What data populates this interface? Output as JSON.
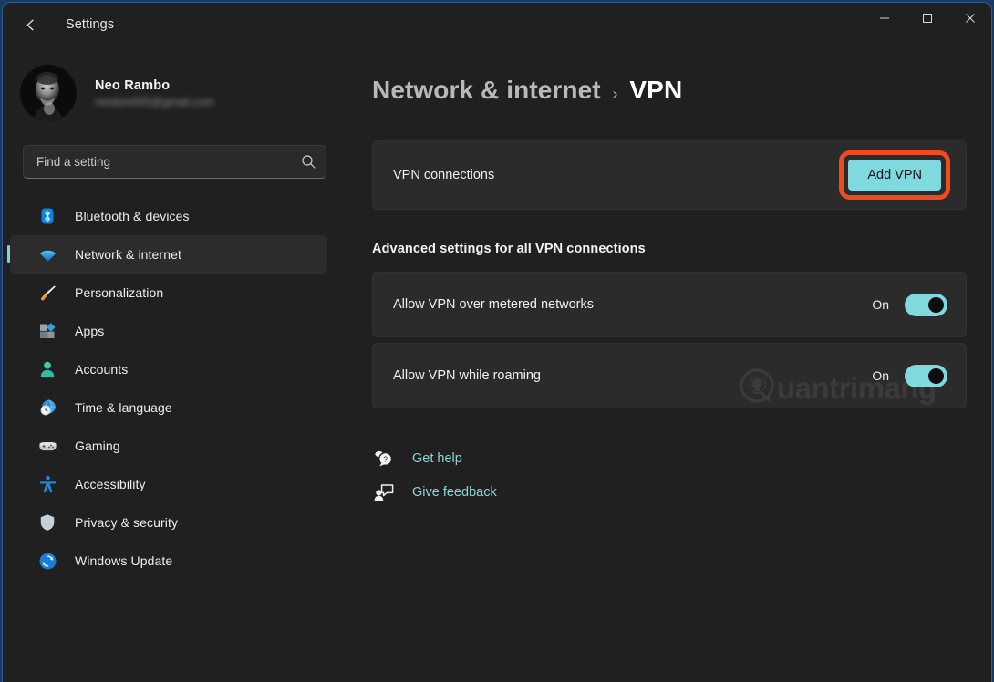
{
  "window": {
    "app_title": "Settings",
    "back_icon": "back-arrow-icon",
    "minimize_label": "—",
    "maximize_label": "□",
    "close_label": "✕",
    "accent_color": "#2f5b93",
    "background_color": "#202020"
  },
  "sidebar": {
    "profile": {
      "name": "Neo Rambo",
      "email": "neokim005@gmail.com",
      "avatar_name": "user-avatar"
    },
    "search": {
      "placeholder": "Find a setting",
      "value": "",
      "icon": "search-icon"
    },
    "items": [
      {
        "label": "Bluetooth & devices",
        "icon": "bluetooth-icon",
        "active": false
      },
      {
        "label": "Network & internet",
        "icon": "wifi-icon",
        "active": true
      },
      {
        "label": "Personalization",
        "icon": "paintbrush-icon",
        "active": false
      },
      {
        "label": "Apps",
        "icon": "apps-grid-icon",
        "active": false
      },
      {
        "label": "Accounts",
        "icon": "person-icon",
        "active": false
      },
      {
        "label": "Time & language",
        "icon": "clock-globe-icon",
        "active": false
      },
      {
        "label": "Gaming",
        "icon": "gamepad-icon",
        "active": false
      },
      {
        "label": "Accessibility",
        "icon": "accessibility-person-icon",
        "active": false
      },
      {
        "label": "Privacy & security",
        "icon": "shield-icon",
        "active": false
      },
      {
        "label": "Windows Update",
        "icon": "refresh-sync-icon",
        "active": false
      }
    ]
  },
  "main": {
    "breadcrumb": {
      "parent": "Network & internet",
      "separator": "›",
      "current": "VPN"
    },
    "vpn_connections": {
      "label": "VPN connections",
      "add_button_label": "Add VPN",
      "highlight_color": "#f04b1e",
      "button_color": "#7fd9de"
    },
    "advanced_heading": "Advanced settings for all VPN connections",
    "settings": [
      {
        "label": "Allow VPN over metered networks",
        "state": "On",
        "toggle_color": "#7fd9de"
      },
      {
        "label": "Allow VPN while roaming",
        "state": "On",
        "toggle_color": "#7fd9de"
      }
    ],
    "links": [
      {
        "label": "Get help",
        "icon": "help-question-icon"
      },
      {
        "label": "Give feedback",
        "icon": "feedback-person-icon"
      }
    ]
  },
  "watermark": {
    "text": "uantrimang",
    "logo_icon": "quantrimang-logo-icon"
  }
}
